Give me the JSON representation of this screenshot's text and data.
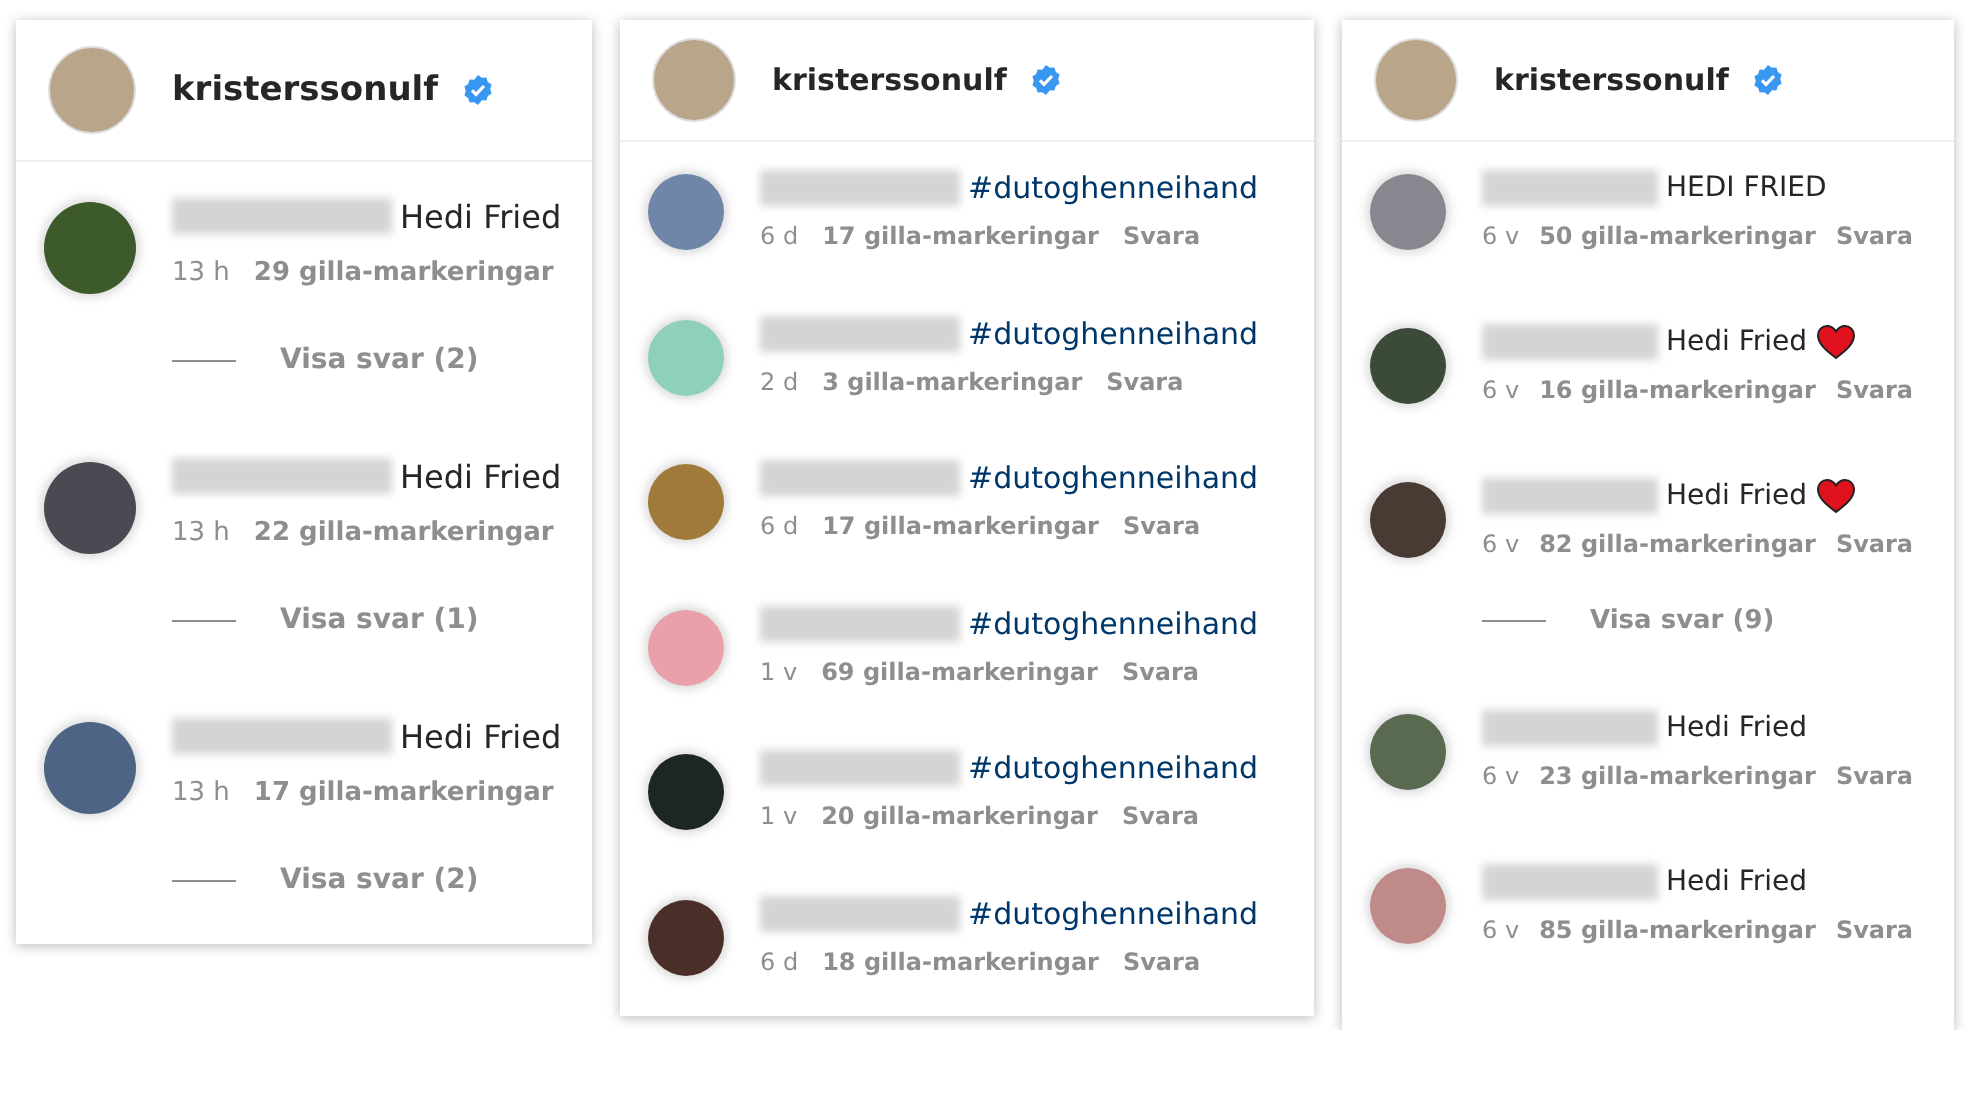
{
  "panels": [
    {
      "account": "kristerssonulf",
      "verified": true,
      "comments": [
        {
          "color": "#3d5a2a",
          "text": "Hedi Fried",
          "kind": "text",
          "heart": false,
          "time": "13 h",
          "likes": "29 gilla-markeringar",
          "replies": "Visa svar (2)"
        },
        {
          "color": "#4a4a52",
          "text": "Hedi Fried",
          "kind": "text",
          "heart": false,
          "time": "13 h",
          "likes": "22 gilla-markeringar",
          "replies": "Visa svar (1)"
        },
        {
          "color": "#4d6485",
          "text": "Hedi Fried",
          "kind": "text",
          "heart": false,
          "time": "13 h",
          "likes": "17 gilla-markeringar",
          "replies": "Visa svar (2)"
        }
      ]
    },
    {
      "account": "kristerssonulf",
      "verified": true,
      "comments": [
        {
          "color": "#6f86a8",
          "text": "#dutoghenneihand",
          "kind": "hashtag",
          "heart": false,
          "time": "6 d",
          "likes": "17 gilla-markeringar",
          "reply": "Svara"
        },
        {
          "color": "#8fd0b8",
          "text": "#dutoghenneihand",
          "kind": "hashtag",
          "heart": false,
          "time": "2 d",
          "likes": "3 gilla-markeringar",
          "reply": "Svara"
        },
        {
          "color": "#a07a3a",
          "text": "#dutoghenneihand",
          "kind": "hashtag",
          "heart": false,
          "time": "6 d",
          "likes": "17 gilla-markeringar",
          "reply": "Svara"
        },
        {
          "color": "#e9a0a8",
          "text": "#dutoghenneihand",
          "kind": "hashtag",
          "heart": false,
          "time": "1 v",
          "likes": "69 gilla-markeringar",
          "reply": "Svara"
        },
        {
          "color": "#1e2624",
          "text": "#dutoghenneihand",
          "kind": "hashtag",
          "heart": false,
          "time": "1 v",
          "likes": "20 gilla-markeringar",
          "reply": "Svara"
        },
        {
          "color": "#4a2e28",
          "text": "#dutoghenneihand",
          "kind": "hashtag",
          "heart": false,
          "time": "6 d",
          "likes": "18 gilla-markeringar",
          "reply": "Svara"
        }
      ]
    },
    {
      "account": "kristerssonulf",
      "verified": true,
      "comments": [
        {
          "color": "#8a8690",
          "text": "HEDI FRIED",
          "kind": "text",
          "heart": false,
          "time": "6 v",
          "likes": "50 gilla-markeringar",
          "reply": "Svara"
        },
        {
          "color": "#3c4a38",
          "text": "Hedi Fried",
          "kind": "text",
          "heart": true,
          "time": "6 v",
          "likes": "16 gilla-markeringar",
          "reply": "Svara"
        },
        {
          "color": "#4a3a34",
          "text": "Hedi Fried",
          "kind": "text",
          "heart": true,
          "time": "6 v",
          "likes": "82 gilla-markeringar",
          "reply": "Svara",
          "replies": "Visa svar (9)"
        },
        {
          "color": "#5a6a50",
          "text": "Hedi Fried",
          "kind": "text",
          "heart": false,
          "time": "6 v",
          "likes": "23 gilla-markeringar",
          "reply": "Svara"
        },
        {
          "color": "#c08a88",
          "text": "Hedi Fried",
          "kind": "text",
          "heart": false,
          "time": "6 v",
          "likes": "85 gilla-markeringar",
          "reply": "Svara"
        }
      ]
    }
  ]
}
